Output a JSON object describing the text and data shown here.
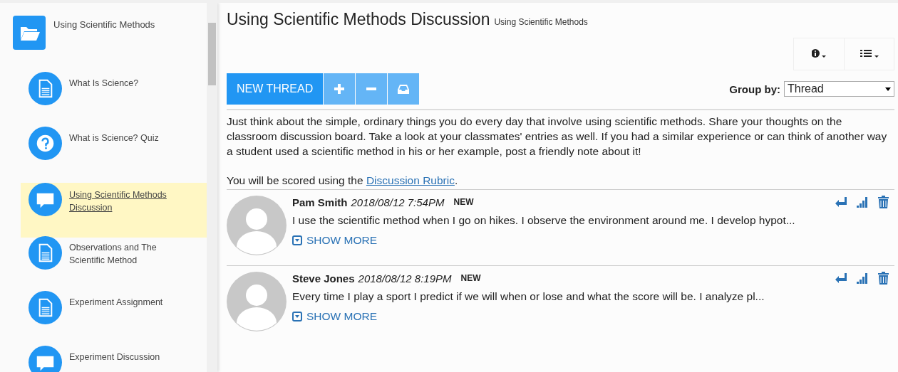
{
  "sidebar": {
    "root": {
      "label": "Using Scientific Methods"
    },
    "items": [
      {
        "label": "What Is Science?",
        "kind": "document",
        "selected": false
      },
      {
        "label": "What is Science? Quiz",
        "kind": "quiz",
        "selected": false
      },
      {
        "label": "Using Scientific Methods Discussion",
        "kind": "discussion",
        "selected": true
      },
      {
        "label": "Observations and The Scientific Method",
        "kind": "document",
        "selected": false
      },
      {
        "label": "Experiment Assignment",
        "kind": "document",
        "selected": false
      },
      {
        "label": "Experiment Discussion",
        "kind": "discussion",
        "selected": false
      }
    ]
  },
  "header": {
    "title": "Using Scientific Methods Discussion",
    "subtitle": "Using Scientific Methods"
  },
  "toolbar": {
    "new_thread": "NEW THREAD",
    "group_by_label": "Group by:",
    "group_by_value": "Thread"
  },
  "description": {
    "text": "Just think about the simple, ordinary things you do every day that involve using scientific methods. Share your thoughts on the classroom discussion board. Take a look at your classmates' entries as well. If you had a similar experience or can think of another way a student used a scientific method in his or her example, post a friendly note about it!",
    "scoring_prefix": "You will be scored using the",
    "scoring_link": "Discussion Rubric",
    "scoring_suffix": "."
  },
  "posts": [
    {
      "author": "Pam Smith",
      "date": "2018/08/12 7:54PM",
      "badge": "NEW",
      "text": "I use the scientific method when I go on hikes. I observe the environment around me. I develop hypot...",
      "show_more": "SHOW MORE"
    },
    {
      "author": "Steve Jones",
      "date": "2018/08/12 8:19PM",
      "badge": "NEW",
      "text": "Every time I play a sport I predict if we will when or lose and what the score will be. I analyze pl...",
      "show_more": "SHOW MORE"
    }
  ]
}
